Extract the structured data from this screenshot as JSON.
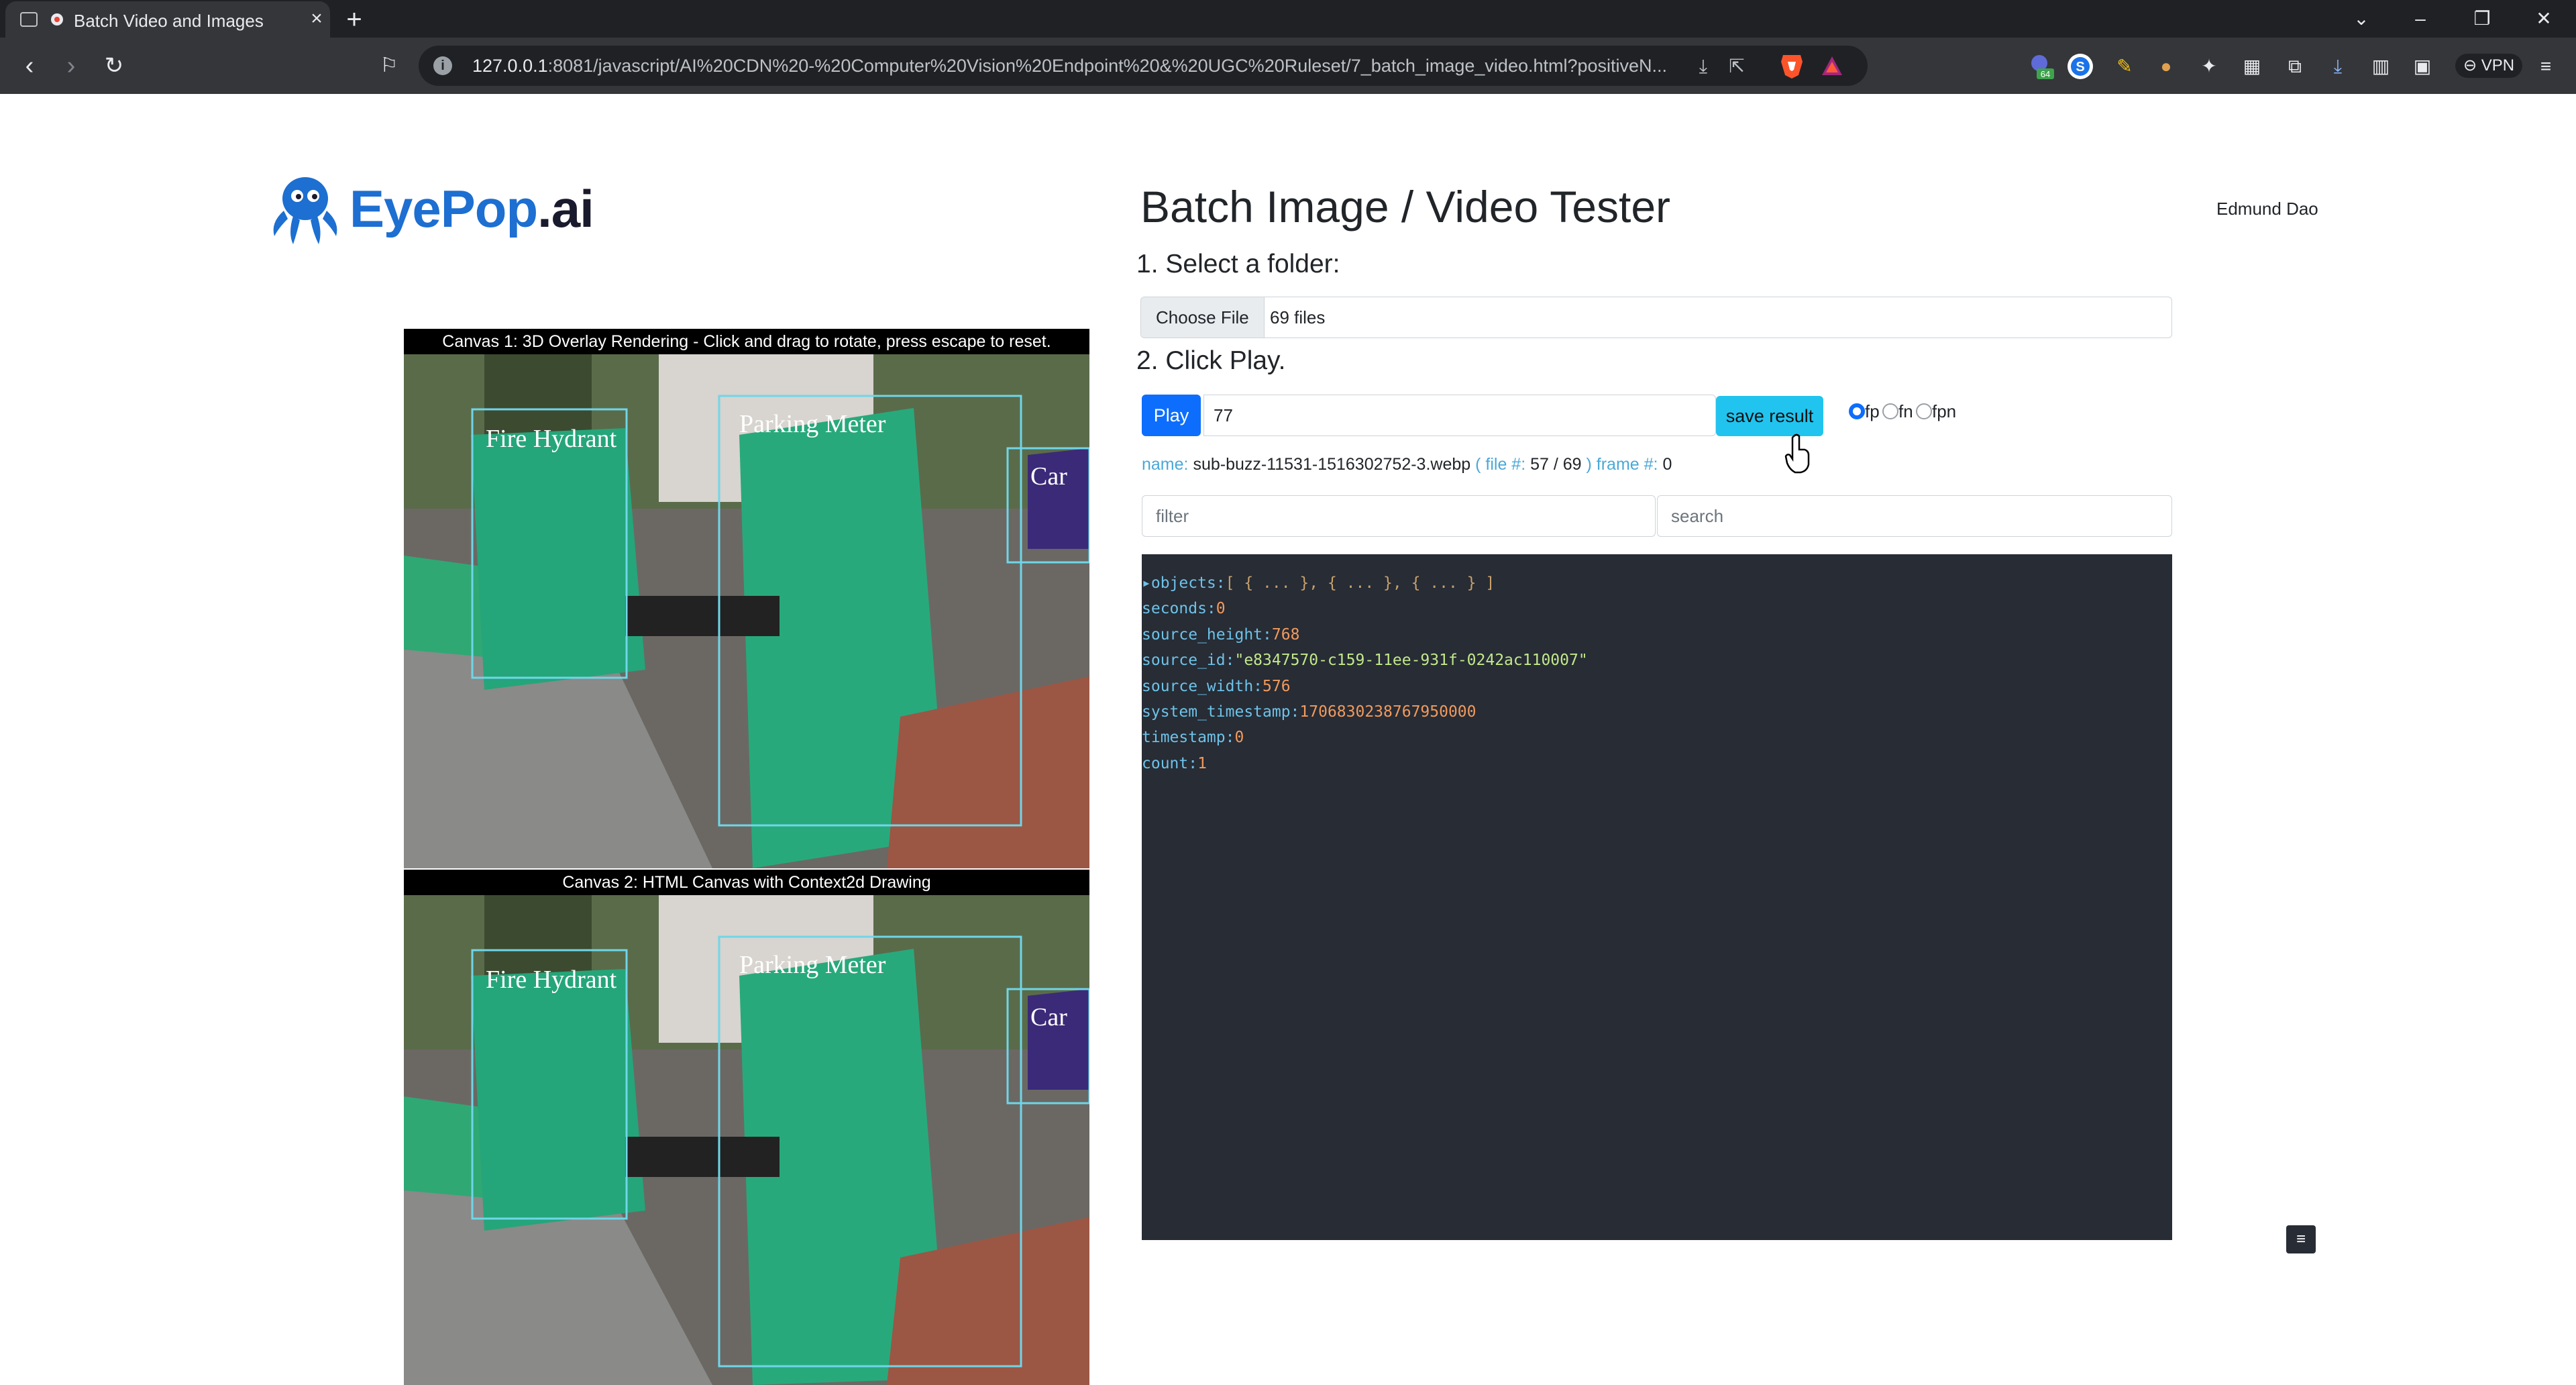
{
  "browser": {
    "tab_title": "Batch Video and Images",
    "url_host": "127.0.0.1",
    "url_rest": ":8081/javascript/AI%20CDN%20-%20Computer%20Vision%20Endpoint%20&%20UGC%20Ruleset/7_batch_image_video.html?positiveN...",
    "vpn_label": "VPN",
    "extension_badge": "64"
  },
  "logo": {
    "text_main": "EyePop",
    "text_suffix": ".ai"
  },
  "header": {
    "title": "Batch Image / Video Tester",
    "user_name": "Edmund Dao"
  },
  "steps": {
    "step1_label": "1. Select a folder:",
    "step2_label": "2. Click Play."
  },
  "file_input": {
    "button_label": "Choose File",
    "selected": "69 files"
  },
  "controls": {
    "play_label": "Play",
    "frame_value": "77",
    "save_label": "save result",
    "radios": [
      {
        "label": "fp",
        "checked": true
      },
      {
        "label": "fn",
        "checked": false
      },
      {
        "label": "fpn",
        "checked": false
      }
    ]
  },
  "info": {
    "name_label": "name:",
    "name_value": "sub-buzz-11531-1516302752-3.webp",
    "file_label": "( file #:",
    "file_value": "57 / 69",
    "frame_label": ") frame #:",
    "frame_value": "0"
  },
  "filter": {
    "placeholder": "filter"
  },
  "search": {
    "placeholder": "search"
  },
  "json_view": {
    "objects_key": "objects:",
    "objects_preview": "[ { ... }, { ... }, { ... } ]",
    "fields": [
      {
        "key": "seconds:",
        "value": "0",
        "type": "num"
      },
      {
        "key": "source_height:",
        "value": "768",
        "type": "num"
      },
      {
        "key": "source_id:",
        "value": "\"e8347570-c159-11ee-931f-0242ac110007\"",
        "type": "str"
      },
      {
        "key": "source_width:",
        "value": "576",
        "type": "num"
      },
      {
        "key": "system_timestamp:",
        "value": "1706830238767950000",
        "type": "num"
      },
      {
        "key": "timestamp:",
        "value": "0",
        "type": "num"
      },
      {
        "key": "count:",
        "value": "1",
        "type": "num"
      }
    ]
  },
  "canvases": [
    {
      "caption": "Canvas 1: 3D Overlay Rendering - Click and drag to rotate, press escape to reset.",
      "labels": [
        "Fire Hydrant",
        "Parking Meter",
        "Car"
      ]
    },
    {
      "caption": "Canvas 2: HTML Canvas with Context2d Drawing",
      "labels": [
        "Fire Hydrant",
        "Parking Meter",
        "Car"
      ]
    }
  ],
  "menu_icon": "menu-icon"
}
